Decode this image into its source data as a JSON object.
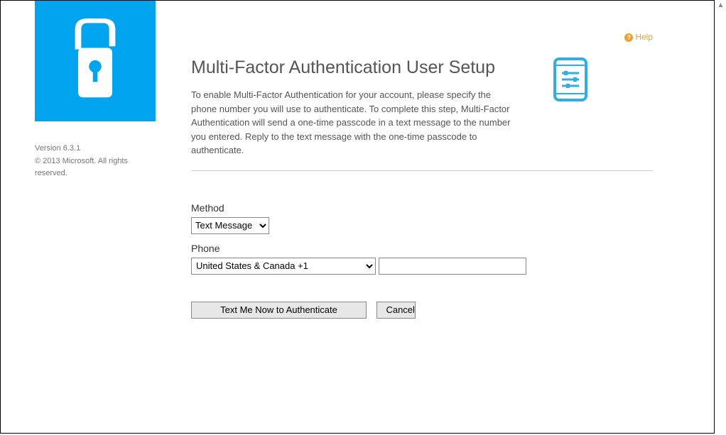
{
  "sidebar": {
    "version": "Version 6.3.1",
    "copyright": "© 2013 Microsoft. All rights reserved."
  },
  "header": {
    "help_label": "Help"
  },
  "main": {
    "title": "Multi-Factor Authentication User Setup",
    "description": "To enable Multi-Factor Authentication for your account, please specify the phone number you will use to authenticate. To complete this step, Multi-Factor Authentication will send a one-time passcode in a text message to the number you entered. Reply to the text message with the one-time passcode to authenticate."
  },
  "form": {
    "method_label": "Method",
    "method_value": "Text Message",
    "phone_label": "Phone",
    "country_value": "United States & Canada +1",
    "phone_value": "",
    "submit_label": "Text Me Now to Authenticate",
    "cancel_label": "Cancel"
  }
}
